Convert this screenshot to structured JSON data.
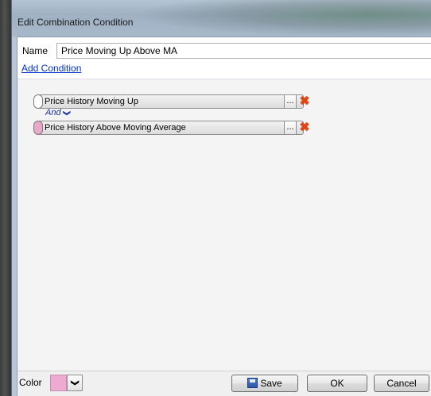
{
  "window": {
    "title": "Edit Combination Condition"
  },
  "form": {
    "name_label": "Name",
    "name_value": "Price Moving Up Above MA",
    "add_condition": "Add Condition"
  },
  "conditions": [
    {
      "label": "Price History Moving Up",
      "more": "...",
      "handle_color": "#ffffff"
    },
    {
      "label": "Price History Above Moving Average",
      "more": "...",
      "handle_color": "#e8a8c8"
    }
  ],
  "operator": {
    "label": "And",
    "chevron": "❯"
  },
  "footer": {
    "color_label": "Color",
    "color_value": "#eeaad0",
    "save": "Save",
    "ok": "OK",
    "cancel": "Cancel"
  },
  "icons": {
    "delete": "✖",
    "dropdown": "❯"
  }
}
